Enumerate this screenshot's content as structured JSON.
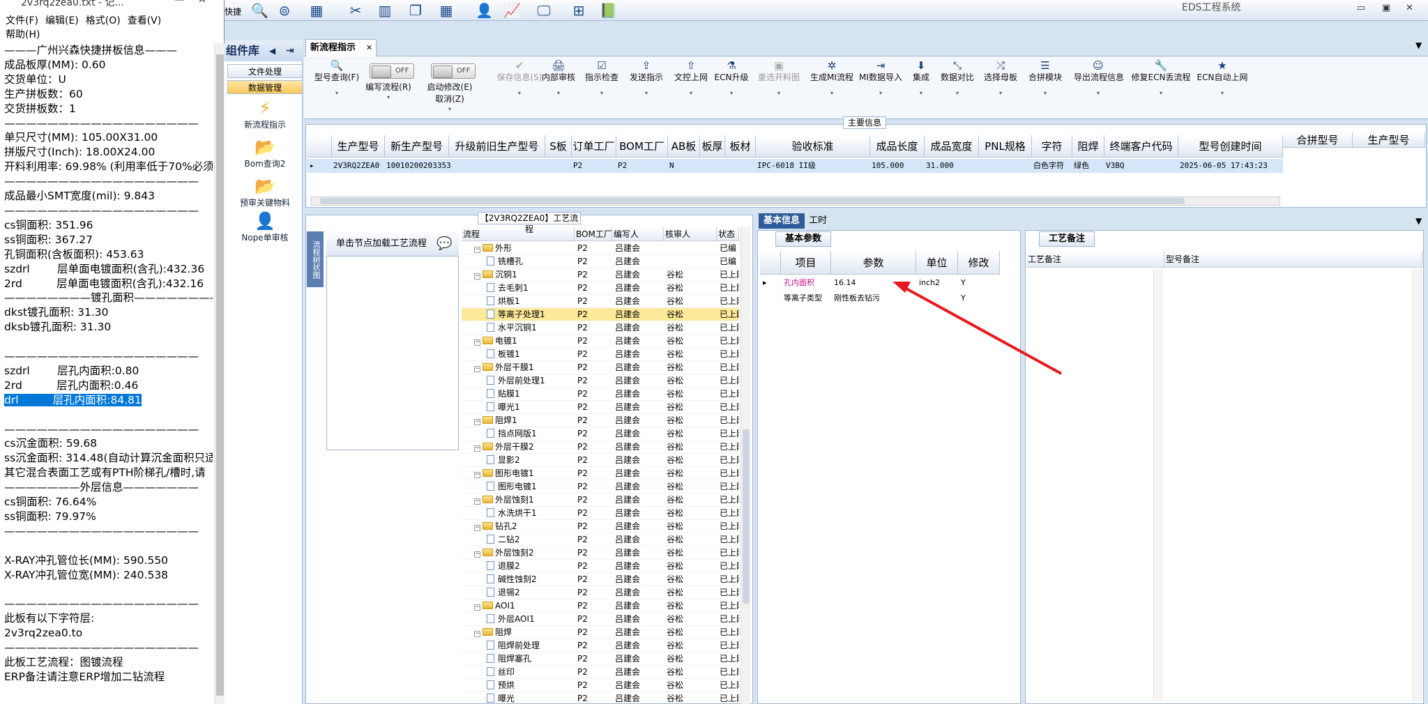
{
  "notepad": {
    "title": "2v3rq2zea0.txt - 记...",
    "menu": [
      "文件(F)",
      "编辑(E)",
      "格式(O)",
      "查看(V)",
      "帮助(H)"
    ],
    "lines": [
      "———广州兴森快捷拼板信息———",
      "成品板厚(MM): 0.60",
      "交货单位：U",
      "生产拼板数：60",
      "交货拼板数：1",
      "——————————————————",
      "单只尺寸(MM): 105.00X31.00",
      "拼版尺寸(Inch): 18.00X24.00",
      "开料利用率: 69.98% (利用率低于70%必须",
      "——————————————————",
      "成品最小SMT宽度(mil): 9.843",
      "——————————————————",
      "cs铜面积: 351.96",
      "ss铜面积: 367.27",
      "孔铜面积(含板面积): 453.63",
      "szdrl        层单面电镀面积(含孔):432.36",
      "2rd          层单面电镀面积(含孔):432.16",
      "————————镀孔面积————————",
      "dkst镀孔面积: 31.30",
      "dksb镀孔面积: 31.30",
      "",
      "——————————————————",
      "szdrl        层孔内面积:0.80",
      "2rd          层孔内面积:0.46",
      "drl          层孔内面积:84.81",
      "",
      "——————————————————",
      "cs沉金面积: 59.68",
      "ss沉金面积: 314.48(自动计算沉金面积只适",
      "其它混合表面工艺或有PTH阶梯孔/槽时,请",
      "———————外层信息———————",
      "cs铜面积: 76.64%",
      "ss铜面积: 79.97%",
      "——————————————————",
      "",
      "X-RAY冲孔管位长(MM): 590.550",
      "X-RAY冲孔管位宽(MM): 240.538",
      "",
      "——————————————————",
      "此板有以下字符层:",
      "2v3rq2zea0.to",
      "——————————————————",
      "此板工艺流程：图镀流程",
      "ERP备注请注意ERP增加二钻流程"
    ],
    "selected_line": "drl          层孔内面积:84.81"
  },
  "app": {
    "title": "EDS工程系统",
    "quick_label": "快捷",
    "icons": [
      "search-icon",
      "lifebuoy-icon",
      "table-icon",
      "scissors-icon",
      "film-icon",
      "copy-icon",
      "grid-icon",
      "user-icon",
      "chart-icon",
      "monitor-icon",
      "windows-icon",
      "book-icon"
    ]
  },
  "comp_panel": {
    "title": "组件库",
    "buttons": [
      "文件处理",
      "数据管理"
    ],
    "items": [
      "新流程指示",
      "Bom查询2",
      "预审关键物料",
      "Nope单审核"
    ]
  },
  "tab": {
    "label": "新流程指示"
  },
  "ribbon": {
    "items": [
      {
        "label": "型号查询(F)",
        "icon": "🔍"
      },
      {
        "label": "编写流程(R)",
        "icon": "",
        "toggle": "OFF"
      },
      {
        "label": "启动修改(E)\n取消(Z)",
        "icon": "",
        "toggle": "OFF"
      },
      {
        "label": "保存信息(S)",
        "icon": "✔",
        "disabled": true
      },
      {
        "label": "内部审核",
        "icon": "🖨"
      },
      {
        "label": "指示检查",
        "icon": "☑"
      },
      {
        "label": "发送指示",
        "icon": "⇪"
      },
      {
        "label": "文控上网",
        "icon": "⇧"
      },
      {
        "label": "ECN升级",
        "icon": "⚗"
      },
      {
        "label": "重选开料图",
        "icon": "▣",
        "disabled": true
      },
      {
        "label": "生成MI流程",
        "icon": "✲"
      },
      {
        "label": "MI数据导入",
        "icon": "⇥"
      },
      {
        "label": "集成",
        "icon": "⬇"
      },
      {
        "label": "数据对比",
        "icon": "⤡"
      },
      {
        "label": "选择母板",
        "icon": "⤮"
      },
      {
        "label": "合拼模块",
        "icon": "☰"
      },
      {
        "label": "导出流程信息",
        "icon": "☺"
      },
      {
        "label": "修复ECN丢流程",
        "icon": "🔧"
      },
      {
        "label": "ECN自动上网",
        "icon": "★"
      }
    ]
  },
  "main_info": {
    "label": "主要信息",
    "columns": [
      "生产型号",
      "新生产型号",
      "升级前旧生产型号",
      "S板",
      "订单工厂",
      "BOM工厂",
      "AB板",
      "板厚",
      "板材",
      "验收标准",
      "成品长度",
      "成品宽度",
      "PNL规格",
      "字符",
      "阻焊",
      "终端客户代码",
      "型号创建时间",
      "合拼型号",
      "生产型号"
    ],
    "row": [
      "2V3RQ2ZEA0",
      "10010200203353",
      "",
      "",
      "P2",
      "P2",
      "N",
      "",
      "",
      "IPC-6018 II级",
      "105.000",
      "31.000",
      "",
      "白色字符",
      "绿色",
      "V3BQ",
      "2025-06-05 17:43:23"
    ]
  },
  "process": {
    "label": "【2V3RQ2ZEA0】工艺流程",
    "load_hint": "单击节点加载工艺流程",
    "side_label": "流程树状图",
    "columns": [
      "流程",
      "BOM工厂",
      "编写人",
      "核审人",
      "状态"
    ],
    "rows": [
      {
        "name": "外形",
        "level": 1,
        "bom": "P2",
        "writer": "吕建会",
        "reviewer": "",
        "status": "已编"
      },
      {
        "name": "铣槽孔",
        "level": 2,
        "bom": "P2",
        "writer": "吕建会",
        "reviewer": "",
        "status": "已编"
      },
      {
        "name": "沉铜1",
        "level": 1,
        "bom": "P2",
        "writer": "吕建会",
        "reviewer": "谷松",
        "status": "已上网"
      },
      {
        "name": "去毛刺1",
        "level": 2,
        "bom": "P2",
        "writer": "吕建会",
        "reviewer": "谷松",
        "status": "已上网"
      },
      {
        "name": "烘板1",
        "level": 2,
        "bom": "P2",
        "writer": "吕建会",
        "reviewer": "谷松",
        "status": "已上网"
      },
      {
        "name": "等离子处理1",
        "level": 2,
        "bom": "P2",
        "writer": "吕建会",
        "reviewer": "谷松",
        "status": "已上网",
        "highlight": true
      },
      {
        "name": "水平沉铜1",
        "level": 2,
        "bom": "P2",
        "writer": "吕建会",
        "reviewer": "谷松",
        "status": "已上网"
      },
      {
        "name": "电镀1",
        "level": 1,
        "bom": "P2",
        "writer": "吕建会",
        "reviewer": "谷松",
        "status": "已上网"
      },
      {
        "name": "板镀1",
        "level": 2,
        "bom": "P2",
        "writer": "吕建会",
        "reviewer": "谷松",
        "status": "已上网"
      },
      {
        "name": "外层干膜1",
        "level": 1,
        "bom": "P2",
        "writer": "吕建会",
        "reviewer": "谷松",
        "status": "已上网"
      },
      {
        "name": "外层前处理1",
        "level": 2,
        "bom": "P2",
        "writer": "吕建会",
        "reviewer": "谷松",
        "status": "已上网"
      },
      {
        "name": "贴膜1",
        "level": 2,
        "bom": "P2",
        "writer": "吕建会",
        "reviewer": "谷松",
        "status": "已上网"
      },
      {
        "name": "曝光1",
        "level": 2,
        "bom": "P2",
        "writer": "吕建会",
        "reviewer": "谷松",
        "status": "已上网"
      },
      {
        "name": "阻焊1",
        "level": 1,
        "bom": "P2",
        "writer": "吕建会",
        "reviewer": "谷松",
        "status": "已上网"
      },
      {
        "name": "挡点网版1",
        "level": 2,
        "bom": "P2",
        "writer": "吕建会",
        "reviewer": "谷松",
        "status": "已上网"
      },
      {
        "name": "外层干膜2",
        "level": 1,
        "bom": "P2",
        "writer": "吕建会",
        "reviewer": "谷松",
        "status": "已上网"
      },
      {
        "name": "显影2",
        "level": 2,
        "bom": "P2",
        "writer": "吕建会",
        "reviewer": "谷松",
        "status": "已上网"
      },
      {
        "name": "图形电镀1",
        "level": 1,
        "bom": "P2",
        "writer": "吕建会",
        "reviewer": "谷松",
        "status": "已上网"
      },
      {
        "name": "图形电镀1",
        "level": 2,
        "bom": "P2",
        "writer": "吕建会",
        "reviewer": "谷松",
        "status": "已上网"
      },
      {
        "name": "外层蚀刻1",
        "level": 1,
        "bom": "P2",
        "writer": "吕建会",
        "reviewer": "谷松",
        "status": "已上网"
      },
      {
        "name": "水洗烘干1",
        "level": 2,
        "bom": "P2",
        "writer": "吕建会",
        "reviewer": "谷松",
        "status": "已上网"
      },
      {
        "name": "钻孔2",
        "level": 1,
        "bom": "P2",
        "writer": "吕建会",
        "reviewer": "谷松",
        "status": "已上网"
      },
      {
        "name": "二钻2",
        "level": 2,
        "bom": "P2",
        "writer": "吕建会",
        "reviewer": "谷松",
        "status": "已上网"
      },
      {
        "name": "外层蚀刻2",
        "level": 1,
        "bom": "P2",
        "writer": "吕建会",
        "reviewer": "谷松",
        "status": "已上网"
      },
      {
        "name": "退膜2",
        "level": 2,
        "bom": "P2",
        "writer": "吕建会",
        "reviewer": "谷松",
        "status": "已上网"
      },
      {
        "name": "碱性蚀刻2",
        "level": 2,
        "bom": "P2",
        "writer": "吕建会",
        "reviewer": "谷松",
        "status": "已上网"
      },
      {
        "name": "退锡2",
        "level": 2,
        "bom": "P2",
        "writer": "吕建会",
        "reviewer": "谷松",
        "status": "已上网"
      },
      {
        "name": "AOI1",
        "level": 1,
        "bom": "P2",
        "writer": "吕建会",
        "reviewer": "谷松",
        "status": "已上网"
      },
      {
        "name": "外层AOI1",
        "level": 2,
        "bom": "P2",
        "writer": "吕建会",
        "reviewer": "谷松",
        "status": "已上网"
      },
      {
        "name": "阻焊",
        "level": 1,
        "bom": "P2",
        "writer": "吕建会",
        "reviewer": "谷松",
        "status": "已上网"
      },
      {
        "name": "阻焊前处理",
        "level": 2,
        "bom": "P2",
        "writer": "吕建会",
        "reviewer": "谷松",
        "status": "已上网"
      },
      {
        "name": "阻焊塞孔",
        "level": 2,
        "bom": "P2",
        "writer": "吕建会",
        "reviewer": "谷松",
        "status": "已上网"
      },
      {
        "name": "丝印",
        "level": 2,
        "bom": "P2",
        "writer": "吕建会",
        "reviewer": "谷松",
        "status": "已上网"
      },
      {
        "name": "预烘",
        "level": 2,
        "bom": "P2",
        "writer": "吕建会",
        "reviewer": "谷松",
        "status": "已上网"
      },
      {
        "name": "曝光",
        "level": 2,
        "bom": "P2",
        "writer": "吕建会",
        "reviewer": "谷松",
        "status": "已上网"
      }
    ]
  },
  "basic": {
    "tabs": [
      "基本信息",
      "工时"
    ],
    "subtab": "基本参数",
    "columns": [
      "项目",
      "参数",
      "单位",
      "修改"
    ],
    "rows": [
      {
        "item": "孔内面积",
        "param": "16.14",
        "unit": "inch2",
        "edit": "Y"
      },
      {
        "item": "等离子类型",
        "param": "刚性板去钻污",
        "unit": "",
        "edit": "Y"
      }
    ]
  },
  "process_notes": {
    "tab": "工艺备注",
    "columns": [
      "工艺备注",
      "型号备注"
    ]
  },
  "colors": {
    "annotation_arrow": "#e8191e",
    "highlight_row": "#fde99a",
    "accent": "#2e5b9a"
  }
}
